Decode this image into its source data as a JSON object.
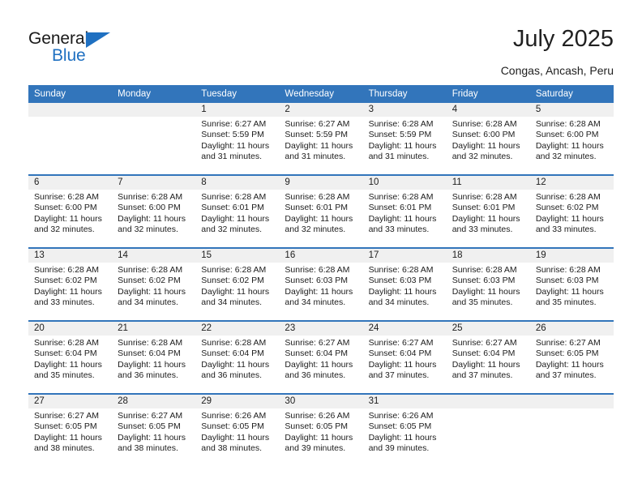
{
  "brand": {
    "name_part1": "General",
    "name_part2": "Blue",
    "accent_color": "#1f70c1"
  },
  "header": {
    "title": "July 2025",
    "subtitle": "Congas, Ancash, Peru"
  },
  "calendar": {
    "header_bg": "#3275bb",
    "daynum_bg": "#f0f0f0",
    "weekdays": [
      "Sunday",
      "Monday",
      "Tuesday",
      "Wednesday",
      "Thursday",
      "Friday",
      "Saturday"
    ],
    "weeks": [
      [
        {
          "day": "",
          "lines": []
        },
        {
          "day": "",
          "lines": []
        },
        {
          "day": "1",
          "lines": [
            "Sunrise: 6:27 AM",
            "Sunset: 5:59 PM",
            "Daylight: 11 hours",
            "and 31 minutes."
          ]
        },
        {
          "day": "2",
          "lines": [
            "Sunrise: 6:27 AM",
            "Sunset: 5:59 PM",
            "Daylight: 11 hours",
            "and 31 minutes."
          ]
        },
        {
          "day": "3",
          "lines": [
            "Sunrise: 6:28 AM",
            "Sunset: 5:59 PM",
            "Daylight: 11 hours",
            "and 31 minutes."
          ]
        },
        {
          "day": "4",
          "lines": [
            "Sunrise: 6:28 AM",
            "Sunset: 6:00 PM",
            "Daylight: 11 hours",
            "and 32 minutes."
          ]
        },
        {
          "day": "5",
          "lines": [
            "Sunrise: 6:28 AM",
            "Sunset: 6:00 PM",
            "Daylight: 11 hours",
            "and 32 minutes."
          ]
        }
      ],
      [
        {
          "day": "6",
          "lines": [
            "Sunrise: 6:28 AM",
            "Sunset: 6:00 PM",
            "Daylight: 11 hours",
            "and 32 minutes."
          ]
        },
        {
          "day": "7",
          "lines": [
            "Sunrise: 6:28 AM",
            "Sunset: 6:00 PM",
            "Daylight: 11 hours",
            "and 32 minutes."
          ]
        },
        {
          "day": "8",
          "lines": [
            "Sunrise: 6:28 AM",
            "Sunset: 6:01 PM",
            "Daylight: 11 hours",
            "and 32 minutes."
          ]
        },
        {
          "day": "9",
          "lines": [
            "Sunrise: 6:28 AM",
            "Sunset: 6:01 PM",
            "Daylight: 11 hours",
            "and 32 minutes."
          ]
        },
        {
          "day": "10",
          "lines": [
            "Sunrise: 6:28 AM",
            "Sunset: 6:01 PM",
            "Daylight: 11 hours",
            "and 33 minutes."
          ]
        },
        {
          "day": "11",
          "lines": [
            "Sunrise: 6:28 AM",
            "Sunset: 6:01 PM",
            "Daylight: 11 hours",
            "and 33 minutes."
          ]
        },
        {
          "day": "12",
          "lines": [
            "Sunrise: 6:28 AM",
            "Sunset: 6:02 PM",
            "Daylight: 11 hours",
            "and 33 minutes."
          ]
        }
      ],
      [
        {
          "day": "13",
          "lines": [
            "Sunrise: 6:28 AM",
            "Sunset: 6:02 PM",
            "Daylight: 11 hours",
            "and 33 minutes."
          ]
        },
        {
          "day": "14",
          "lines": [
            "Sunrise: 6:28 AM",
            "Sunset: 6:02 PM",
            "Daylight: 11 hours",
            "and 34 minutes."
          ]
        },
        {
          "day": "15",
          "lines": [
            "Sunrise: 6:28 AM",
            "Sunset: 6:02 PM",
            "Daylight: 11 hours",
            "and 34 minutes."
          ]
        },
        {
          "day": "16",
          "lines": [
            "Sunrise: 6:28 AM",
            "Sunset: 6:03 PM",
            "Daylight: 11 hours",
            "and 34 minutes."
          ]
        },
        {
          "day": "17",
          "lines": [
            "Sunrise: 6:28 AM",
            "Sunset: 6:03 PM",
            "Daylight: 11 hours",
            "and 34 minutes."
          ]
        },
        {
          "day": "18",
          "lines": [
            "Sunrise: 6:28 AM",
            "Sunset: 6:03 PM",
            "Daylight: 11 hours",
            "and 35 minutes."
          ]
        },
        {
          "day": "19",
          "lines": [
            "Sunrise: 6:28 AM",
            "Sunset: 6:03 PM",
            "Daylight: 11 hours",
            "and 35 minutes."
          ]
        }
      ],
      [
        {
          "day": "20",
          "lines": [
            "Sunrise: 6:28 AM",
            "Sunset: 6:04 PM",
            "Daylight: 11 hours",
            "and 35 minutes."
          ]
        },
        {
          "day": "21",
          "lines": [
            "Sunrise: 6:28 AM",
            "Sunset: 6:04 PM",
            "Daylight: 11 hours",
            "and 36 minutes."
          ]
        },
        {
          "day": "22",
          "lines": [
            "Sunrise: 6:28 AM",
            "Sunset: 6:04 PM",
            "Daylight: 11 hours",
            "and 36 minutes."
          ]
        },
        {
          "day": "23",
          "lines": [
            "Sunrise: 6:27 AM",
            "Sunset: 6:04 PM",
            "Daylight: 11 hours",
            "and 36 minutes."
          ]
        },
        {
          "day": "24",
          "lines": [
            "Sunrise: 6:27 AM",
            "Sunset: 6:04 PM",
            "Daylight: 11 hours",
            "and 37 minutes."
          ]
        },
        {
          "day": "25",
          "lines": [
            "Sunrise: 6:27 AM",
            "Sunset: 6:04 PM",
            "Daylight: 11 hours",
            "and 37 minutes."
          ]
        },
        {
          "day": "26",
          "lines": [
            "Sunrise: 6:27 AM",
            "Sunset: 6:05 PM",
            "Daylight: 11 hours",
            "and 37 minutes."
          ]
        }
      ],
      [
        {
          "day": "27",
          "lines": [
            "Sunrise: 6:27 AM",
            "Sunset: 6:05 PM",
            "Daylight: 11 hours",
            "and 38 minutes."
          ]
        },
        {
          "day": "28",
          "lines": [
            "Sunrise: 6:27 AM",
            "Sunset: 6:05 PM",
            "Daylight: 11 hours",
            "and 38 minutes."
          ]
        },
        {
          "day": "29",
          "lines": [
            "Sunrise: 6:26 AM",
            "Sunset: 6:05 PM",
            "Daylight: 11 hours",
            "and 38 minutes."
          ]
        },
        {
          "day": "30",
          "lines": [
            "Sunrise: 6:26 AM",
            "Sunset: 6:05 PM",
            "Daylight: 11 hours",
            "and 39 minutes."
          ]
        },
        {
          "day": "31",
          "lines": [
            "Sunrise: 6:26 AM",
            "Sunset: 6:05 PM",
            "Daylight: 11 hours",
            "and 39 minutes."
          ]
        },
        {
          "day": "",
          "lines": []
        },
        {
          "day": "",
          "lines": []
        }
      ]
    ]
  }
}
